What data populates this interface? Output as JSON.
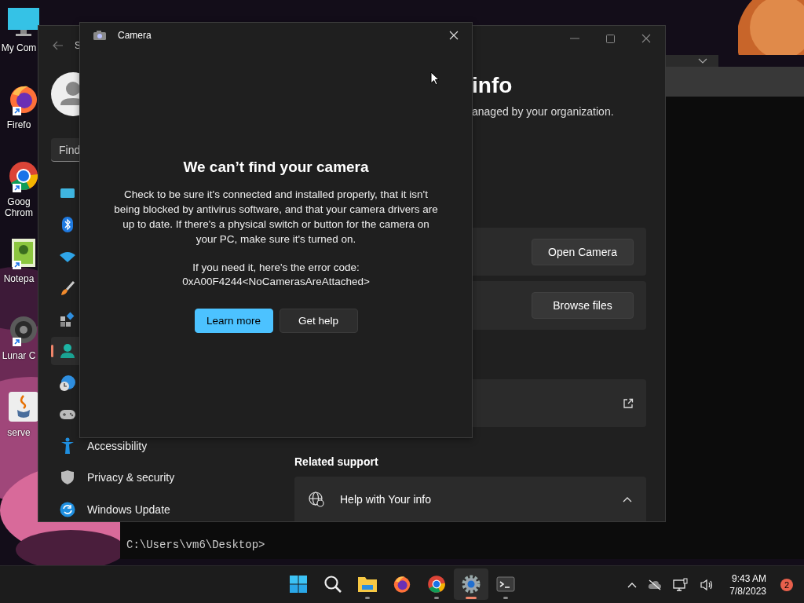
{
  "desktop": {
    "icons": [
      {
        "label": "My Com",
        "shortcut": false
      },
      {
        "label": "Firefo",
        "shortcut": true
      },
      {
        "label": "Goog Chrom",
        "shortcut": true
      },
      {
        "label": "Notepa",
        "shortcut": true
      },
      {
        "label": "Lunar C",
        "shortcut": true
      },
      {
        "label": "serve",
        "shortcut": false
      }
    ]
  },
  "terminal": {
    "prompt": "C:\\Users\\vm6\\Desktop>"
  },
  "settings": {
    "title": "S",
    "search": {
      "placeholder": "Find"
    },
    "nav": [
      {
        "selected": false
      },
      {
        "selected": false
      },
      {
        "selected": false
      },
      {
        "selected": false
      },
      {
        "selected": false
      },
      {
        "selected": true
      },
      {
        "selected": false
      },
      {
        "selected": false
      },
      {
        "label": "Accessibility",
        "selected": false
      },
      {
        "label": "Privacy & security",
        "selected": false
      },
      {
        "label": "Windows Update",
        "selected": false
      }
    ],
    "heading": "info",
    "subtitle": "anaged by your organization.",
    "rows": [
      {
        "kind": "button",
        "button": "Open Camera"
      },
      {
        "kind": "button",
        "button": "Browse files"
      },
      {
        "kind": "link"
      }
    ],
    "related_support": {
      "title": "Related support",
      "item": {
        "label": "Help with Your info",
        "expanded": true
      }
    }
  },
  "camera": {
    "title": "Camera",
    "heading": "We can’t find your camera",
    "message": "Check to be sure it's connected and installed properly, that it isn't being blocked by antivirus software, and that your camera drivers are up to date. If there's a physical switch or button for the camera on your PC, make sure it's turned on.",
    "error_intro": "If you need it, here's the error code:",
    "error_code": "0xA00F4244<NoCamerasAreAttached>",
    "buttons": [
      {
        "label": "Learn more",
        "primary": true
      },
      {
        "label": "Get help",
        "primary": false
      }
    ]
  },
  "taskbar": {
    "apps": [
      {
        "running": false,
        "active": false
      },
      {
        "running": false,
        "active": false
      },
      {
        "running": true,
        "active": false
      },
      {
        "running": false,
        "active": false
      },
      {
        "running": true,
        "active": false
      },
      {
        "running": true,
        "active": true
      },
      {
        "running": true,
        "active": false
      }
    ],
    "time": "9:43 AM",
    "date": "7/8/2023",
    "notifications": "2"
  }
}
